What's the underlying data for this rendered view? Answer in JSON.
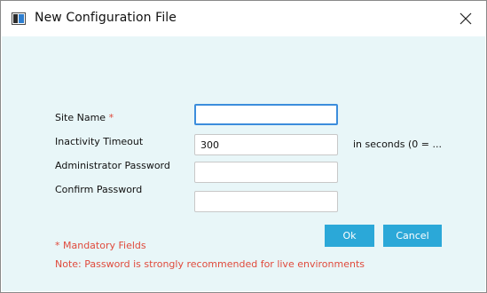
{
  "window": {
    "title": "New Configuration File"
  },
  "form": {
    "site_name_label": "Site Name",
    "required_marker": "*",
    "site_name_value": "",
    "inactivity_timeout_label": "Inactivity Timeout",
    "inactivity_timeout_value": "300",
    "inactivity_timeout_hint": "in seconds (0 = ...",
    "admin_password_label": "Administrator Password",
    "admin_password_value": "",
    "confirm_password_label": "Confirm Password",
    "confirm_password_value": ""
  },
  "buttons": {
    "ok_label": "Ok",
    "cancel_label": "Cancel"
  },
  "notes": {
    "mandatory": "* Mandatory Fields",
    "password_note": "Note: Password is strongly recommended for live environments"
  },
  "colors": {
    "accent": "#2ba8d8",
    "focus_border": "#3c8ddc",
    "warning_text": "#e04a3c",
    "content_background": "#e8f6f8"
  },
  "icons": {
    "app": "app-window-icon",
    "close": "close-icon"
  }
}
